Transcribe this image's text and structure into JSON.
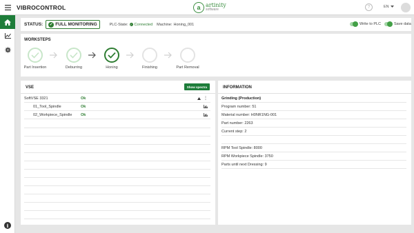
{
  "header": {
    "app_title": "VIBROCONTROL",
    "logo_primary": "artinity",
    "logo_secondary": "software",
    "language": "EN"
  },
  "status": {
    "label": "STATUS:",
    "monitoring": "FULL MONITORING",
    "plc_label": "PLC-State:",
    "plc_state": "Connected",
    "machine_label": "Machine:",
    "machine": "Honing_001",
    "write_to_plc": "Write to PLC",
    "save_data": "Save data"
  },
  "worksteps": {
    "title": "WORKSTEPS",
    "steps": [
      {
        "label": "Part Insertion",
        "state": "done"
      },
      {
        "label": "Deburring",
        "state": "done"
      },
      {
        "label": "Honing",
        "state": "active"
      },
      {
        "label": "Finishing",
        "state": "pending"
      },
      {
        "label": "Part Removal",
        "state": "pending"
      }
    ]
  },
  "vse": {
    "title": "VSE",
    "show_spectra": "Show spectra",
    "rows": [
      {
        "name": "SoftVSE 3321",
        "status": "Ok"
      },
      {
        "name": "01_Tool_Spindle",
        "status": "Ok"
      },
      {
        "name": "02_Workpiece_Spindle",
        "status": "Ok"
      }
    ]
  },
  "information": {
    "title": "INFORMATION",
    "heading": "Grinding (Production)",
    "program_number": "Program number: 51",
    "material_number": "Material number: H0NR1NG-001",
    "part_number": "Part number: 2263",
    "current_step": "Current step: 2",
    "rpm_tool": "RPM Tool Spindle: 8000",
    "rpm_workpiece": "RPM Workpiece Spindle: 3750",
    "parts_until_dressing": "Parts until next Dressing: 9"
  },
  "colors": {
    "brand_green": "#1e7d3a",
    "ok_green": "#2e7d32"
  }
}
